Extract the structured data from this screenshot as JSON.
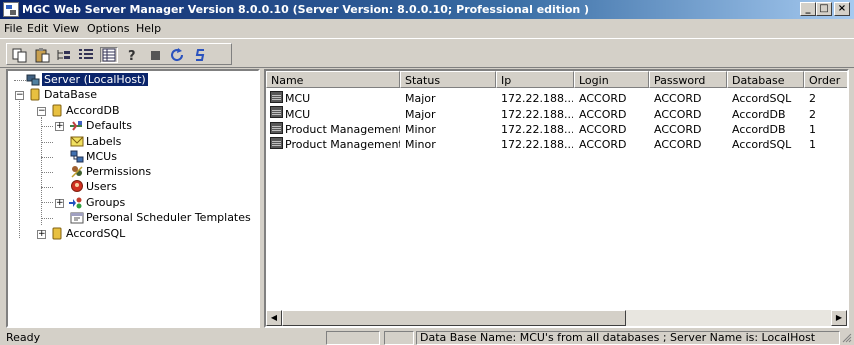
{
  "window": {
    "title": "MGC Web Server Manager Version 8.0.0.10  (Server Version: 8.0.0.10;  Professional edition )",
    "minimize": "_",
    "maximize": "□",
    "close": "×"
  },
  "menu": [
    "File",
    "Edit",
    "View",
    "Options",
    "Help"
  ],
  "toolbar": {
    "buttons": [
      "copy-icon",
      "paste-icon",
      "tree-icon",
      "details-list-icon",
      "grid-view-icon",
      "help-icon",
      "stop-icon",
      "refresh-icon",
      "sync-icon"
    ]
  },
  "tree": {
    "server": "Server (LocalHost)",
    "database": "DataBase",
    "accorddb": "AccordDB",
    "defaults": "Defaults",
    "labels": "Labels",
    "mcus": "MCUs",
    "permissions": "Permissions",
    "users": "Users",
    "groups": "Groups",
    "scheduler": "Personal Scheduler Templates",
    "accordsql": "AccordSQL",
    "expand_minus": "−",
    "expand_plus": "+"
  },
  "list": {
    "columns": [
      "Name",
      "Status",
      "Ip",
      "Login",
      "Password",
      "Database",
      "Order"
    ],
    "rows": [
      [
        "MCU",
        "Major",
        "172.22.188...",
        "ACCORD",
        "ACCORD",
        "AccordSQL",
        "2"
      ],
      [
        "MCU",
        "Major",
        "172.22.188...",
        "ACCORD",
        "ACCORD",
        "AccordDB",
        "2"
      ],
      [
        "Product Management",
        "Minor",
        "172.22.188...",
        "ACCORD",
        "ACCORD",
        "AccordDB",
        "1"
      ],
      [
        "Product Management ...",
        "Minor",
        "172.22.188...",
        "ACCORD",
        "ACCORD",
        "AccordSQL",
        "1"
      ]
    ],
    "scroll_left": "◀",
    "scroll_right": "▶"
  },
  "status": {
    "ready": "Ready",
    "info": "Data Base Name: MCU's from all databases ; Server Name is: LocalHost"
  }
}
